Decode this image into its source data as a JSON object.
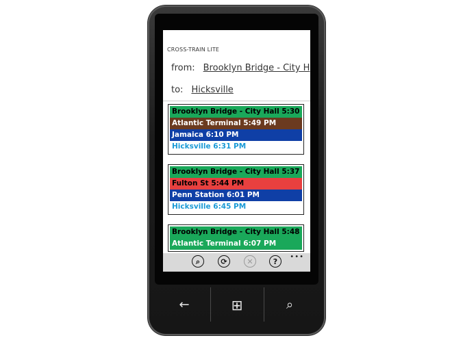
{
  "app": {
    "title": "CROSS-TRAIN LITE"
  },
  "route": {
    "from_label": "from:",
    "from_value": "Brooklyn Bridge - City H",
    "to_label": "to:",
    "to_value": "Hicksville"
  },
  "trips": [
    {
      "stops": [
        {
          "text": "Brooklyn Bridge - City Hall 5:30 PM",
          "bg": "#1aa85a",
          "fg": "#000000"
        },
        {
          "text": "Atlantic Terminal 5:49 PM",
          "bg": "#6b3a1f",
          "fg": "#ffffff"
        },
        {
          "text": "Jamaica 6:10 PM",
          "bg": "#0f3fa6",
          "fg": "#ffffff"
        },
        {
          "text": "Hicksville 6:31 PM",
          "bg": "#ffffff",
          "fg": "#1a9ad6"
        }
      ]
    },
    {
      "stops": [
        {
          "text": "Brooklyn Bridge - City Hall 5:37 PM",
          "bg": "#1aa85a",
          "fg": "#000000"
        },
        {
          "text": "Fulton St 5:44 PM",
          "bg": "#e8403f",
          "fg": "#000000"
        },
        {
          "text": "Penn Station 6:01 PM",
          "bg": "#0f3fa6",
          "fg": "#ffffff"
        },
        {
          "text": "Hicksville 6:45 PM",
          "bg": "#ffffff",
          "fg": "#1a9ad6"
        }
      ]
    },
    {
      "stops": [
        {
          "text": "Brooklyn Bridge - City Hall 5:48 PM",
          "bg": "#1aa85a",
          "fg": "#000000"
        },
        {
          "text": "Atlantic Terminal 6:07 PM",
          "bg": "#1aa85a",
          "fg": "#ffffff"
        }
      ]
    }
  ],
  "appbar": {
    "buttons": [
      {
        "name": "search-icon",
        "glyph": "⌕",
        "enabled": true
      },
      {
        "name": "refresh-icon",
        "glyph": "⟳",
        "enabled": true
      },
      {
        "name": "cancel-icon",
        "glyph": "✕",
        "enabled": false
      },
      {
        "name": "help-icon",
        "glyph": "?",
        "enabled": true
      }
    ],
    "more": "•••"
  },
  "hardware": {
    "back": "←",
    "start": "⊞",
    "search": "⌕"
  },
  "colors": {
    "phone_body": "#1c1c1c",
    "appbar_bg": "#d9d9d9"
  }
}
